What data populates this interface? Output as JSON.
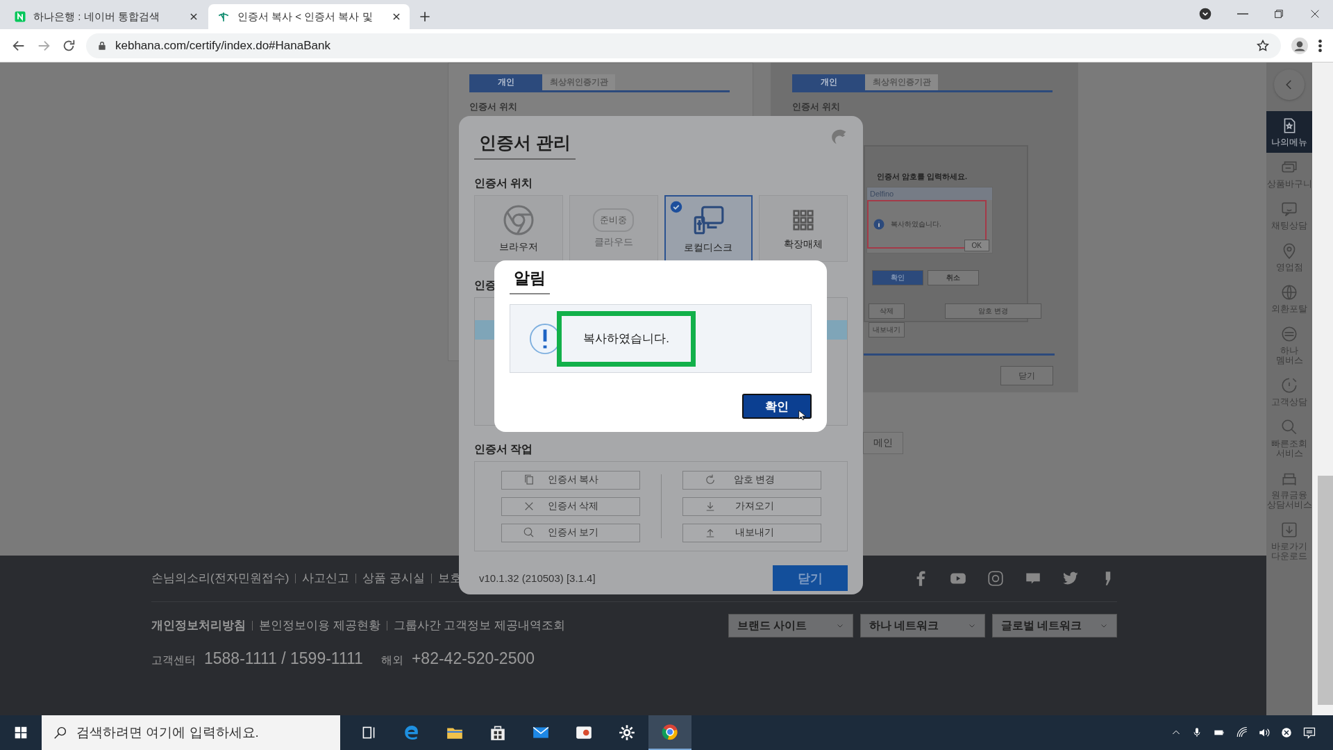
{
  "browser": {
    "tabs": [
      {
        "title": "하나은행 : 네이버 통합검색",
        "selected": false
      },
      {
        "title": "인증서 복사 < 인증서 복사 및",
        "selected": true
      }
    ],
    "url": "kebhana.com/certify/index.do#HanaBank"
  },
  "guide_images": [
    {
      "tabs": [
        {
          "label": "개인",
          "selected": true
        },
        {
          "label": "최상위인증기관",
          "selected": false
        }
      ],
      "heading": "인증서 위치"
    },
    {
      "tabs": [
        {
          "label": "개인",
          "selected": true
        },
        {
          "label": "최상위인증기관",
          "selected": false
        }
      ],
      "heading": "인증서 위치",
      "password_dialog": {
        "prompt": "인증서 암호를 입력하세요.",
        "popup_title": "Delfino",
        "popup_message": "복사하였습니다.",
        "popup_button": "OK",
        "buttons": [
          {
            "label": "확인",
            "primary": true
          },
          {
            "label": "취소",
            "primary": false
          }
        ]
      },
      "left_buttons": [
        "삭제",
        "내보내기"
      ],
      "right_button": "암호 변경",
      "close_button": "닫기"
    }
  ],
  "main_button": "메인",
  "cert_manager": {
    "title": "인증서 관리",
    "location_heading": "인증서 위치",
    "locations": [
      {
        "label": "브라우저",
        "selected": false,
        "disabled": false
      },
      {
        "label": "클라우드",
        "selected": false,
        "disabled": true,
        "badge": "준비중"
      },
      {
        "label": "로컬디스크",
        "selected": true,
        "disabled": false
      },
      {
        "label": "확장매체",
        "selected": false,
        "disabled": false
      }
    ],
    "list_heading": "인증",
    "tasks_heading": "인증서 작업",
    "tasks": [
      {
        "label": "인증서 복사"
      },
      {
        "label": "인증서 삭제"
      },
      {
        "label": "인증서 보기"
      },
      {
        "label": "암호 변경"
      },
      {
        "label": "가져오기"
      },
      {
        "label": "내보내기"
      }
    ],
    "version": "v10.1.32 (210503) [3.1.4]",
    "close_button": "닫기"
  },
  "alert": {
    "title": "알림",
    "message": "복사하였습니다.",
    "confirm_button": "확인"
  },
  "footer": {
    "links": [
      "손님의소리(전자민원접수)",
      "사고신고",
      "상품 공시실",
      "보호"
    ],
    "policy_links": [
      {
        "label": "개인정보처리방침",
        "bold": true
      },
      {
        "label": "본인정보이용 제공현황",
        "bold": false
      },
      {
        "label": "그룹사간 고객정보 제공내역조회",
        "bold": false
      }
    ],
    "dropdowns": [
      "브랜드 사이트",
      "하나 네트워크",
      "글로벌 네트워크"
    ],
    "contact": {
      "label": "고객센터",
      "phones": "1588-1111 / 1599-1111",
      "overseas_label": "해외",
      "overseas_phone": "+82-42-520-2500"
    }
  },
  "sidebar": {
    "items": [
      {
        "label": "나의메뉴",
        "selected": true
      },
      {
        "label": "상품바구니",
        "selected": false
      },
      {
        "label": "채팅상담",
        "selected": false
      },
      {
        "label": "영업점",
        "selected": false
      },
      {
        "label": "외환포탈",
        "selected": false
      },
      {
        "label": "하나\n멤버스",
        "selected": false
      },
      {
        "label": "고객상담",
        "selected": false
      },
      {
        "label": "빠른조회\n서비스",
        "selected": false
      },
      {
        "label": "원큐금융\n상담서비스",
        "selected": false
      },
      {
        "label": "바로가기\n다운로드",
        "selected": false
      }
    ]
  },
  "taskbar": {
    "search_placeholder": "검색하려면 여기에 입력하세요."
  }
}
